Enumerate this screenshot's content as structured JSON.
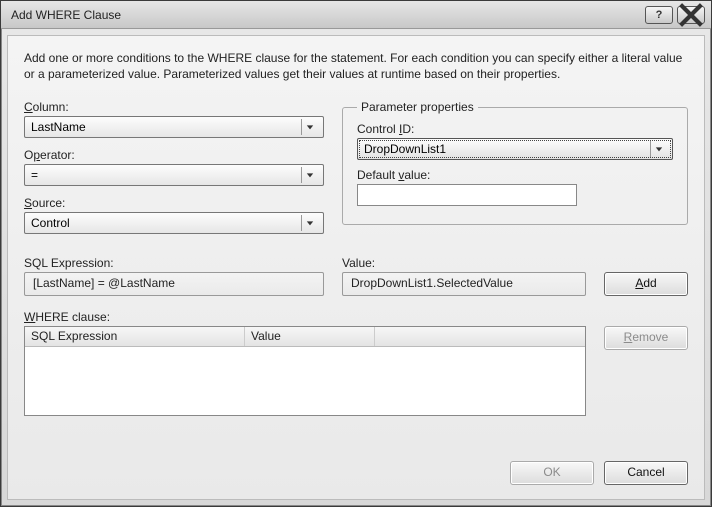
{
  "title": "Add WHERE Clause",
  "intro": "Add one or more conditions to the WHERE clause for the statement. For each condition you can specify either a literal value or a parameterized value. Parameterized values get their values at runtime based on their properties.",
  "labels": {
    "column": "Column:",
    "operator": "Operator:",
    "source": "Source:",
    "paramprops": "Parameter properties",
    "controlid": "Control ID:",
    "defaultvalue": "Default value:",
    "sqlexpr": "SQL Expression:",
    "value": "Value:",
    "where": "WHERE clause:"
  },
  "fields": {
    "column": "LastName",
    "operator": "=",
    "source": "Control",
    "controlid": "DropDownList1",
    "defaultvalue": "",
    "sqlexpr": "[LastName] = @LastName",
    "value": "DropDownList1.SelectedValue"
  },
  "table": {
    "headers": {
      "c1": "SQL Expression",
      "c2": "Value",
      "c3": ""
    }
  },
  "buttons": {
    "add": "Add",
    "remove": "Remove",
    "ok": "OK",
    "cancel": "Cancel"
  }
}
